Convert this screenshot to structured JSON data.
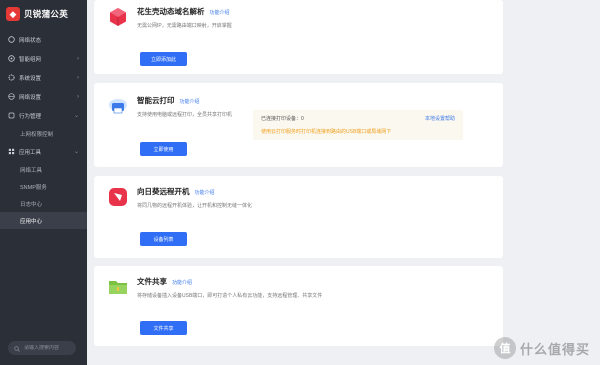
{
  "brand": {
    "name": "贝锐蒲公英"
  },
  "sidebar": {
    "items": [
      {
        "label": "网络状态",
        "icon": "status-icon",
        "arrow": ""
      },
      {
        "label": "智能组网",
        "icon": "network-icon",
        "arrow": "›"
      },
      {
        "label": "系统设置",
        "icon": "settings-icon",
        "arrow": "›"
      },
      {
        "label": "网络设置",
        "icon": "globe-icon",
        "arrow": "›"
      },
      {
        "label": "行为管理",
        "icon": "behavior-icon",
        "arrow": "⌄"
      },
      {
        "label": "上网权限控制",
        "icon": "",
        "arrow": ""
      },
      {
        "label": "应用工具",
        "icon": "tools-icon",
        "arrow": "⌄"
      },
      {
        "label": "网络工具",
        "icon": "",
        "arrow": ""
      },
      {
        "label": "SNMP服务",
        "icon": "",
        "arrow": ""
      },
      {
        "label": "日志中心",
        "icon": "",
        "arrow": ""
      },
      {
        "label": "应用中心",
        "icon": "",
        "arrow": ""
      }
    ],
    "search_placeholder": "请输入搜索内容"
  },
  "cards": [
    {
      "title": "花生壳动态域名解析",
      "help": "功能介绍",
      "desc": "无需公网IP，无需路由端口映射，开启掌握",
      "button": "立即添加此",
      "icon": "peanut-shell-icon"
    },
    {
      "title": "智能云打印",
      "help": "功能介绍",
      "desc": "支持使用电脑或远程打印，全员共享打印机",
      "button": "立即使用",
      "icon": "cloud-print-icon",
      "info": {
        "count": "已连接打印设备：0",
        "local_link": "本地设置帮助",
        "warn": "使用云打印服务时打印机连接到路由的USB端口或局域网下"
      }
    },
    {
      "title": "向日葵远程开机",
      "help": "功能介绍",
      "desc": "将同几物的远程开机体验，让开机和控制无缝一体化",
      "button": "设备列表",
      "icon": "sunflower-icon"
    },
    {
      "title": "文件共享",
      "help": "功能介绍",
      "desc": "将存储设备插入设备USB端口，即可打造个人私有云功能，支持远程管理、共享文件",
      "button": "文件共享",
      "icon": "folder-icon"
    }
  ],
  "watermark": {
    "text": "什么值得买",
    "logo": "值"
  },
  "colors": {
    "accent": "#2f6ef5",
    "sidebar_bg": "#2b2f38",
    "warn": "#f0a020"
  }
}
